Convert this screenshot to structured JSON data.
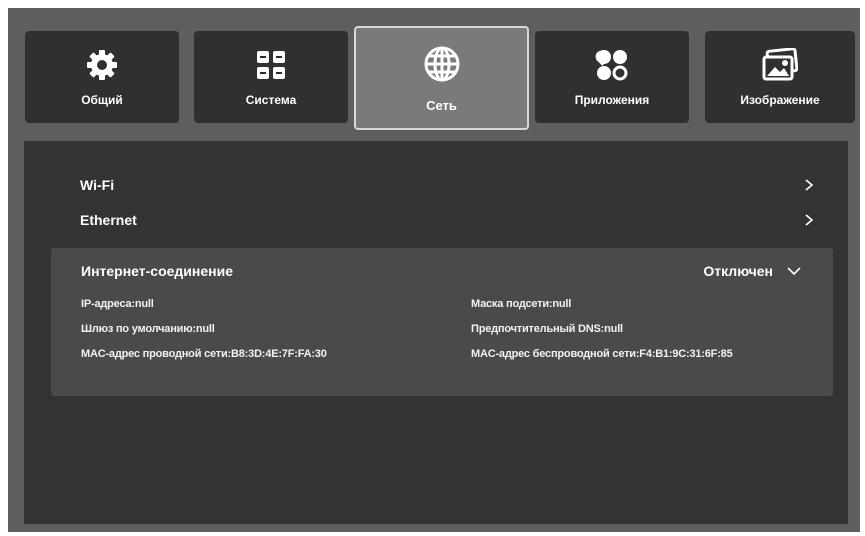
{
  "tabs": [
    {
      "label": "Общий",
      "icon": "gear-icon",
      "active": false
    },
    {
      "label": "Система",
      "icon": "apps-grid-icon",
      "active": false
    },
    {
      "label": "Сеть",
      "icon": "globe-icon",
      "active": true
    },
    {
      "label": "Приложения",
      "icon": "apps-shapes-icon",
      "active": false
    },
    {
      "label": "Изображение",
      "icon": "image-icon",
      "active": false
    }
  ],
  "network": {
    "wifi_label": "Wi-Fi",
    "ethernet_label": "Ethernet"
  },
  "internet": {
    "title": "Интернет-соединение",
    "status": "Отключен",
    "ip": "IP-адреса:null",
    "subnet": "Маска подсети:null",
    "gateway": "Шлюз по умолчанию:null",
    "dns": "Предпочтительный DNS:null",
    "mac_wired": "MAC-адрес проводной сети:B8:3D:4E:7F:FA:30",
    "mac_wireless": "MAC-адрес беспроводной сети:F4:B1:9C:31:6F:85"
  },
  "colors": {
    "background": "#5e5e5e",
    "tab": "#303030",
    "tab_active": "#7a7a7a",
    "panel": "#333333",
    "card": "#4a4a4a",
    "text": "#ffffff"
  }
}
